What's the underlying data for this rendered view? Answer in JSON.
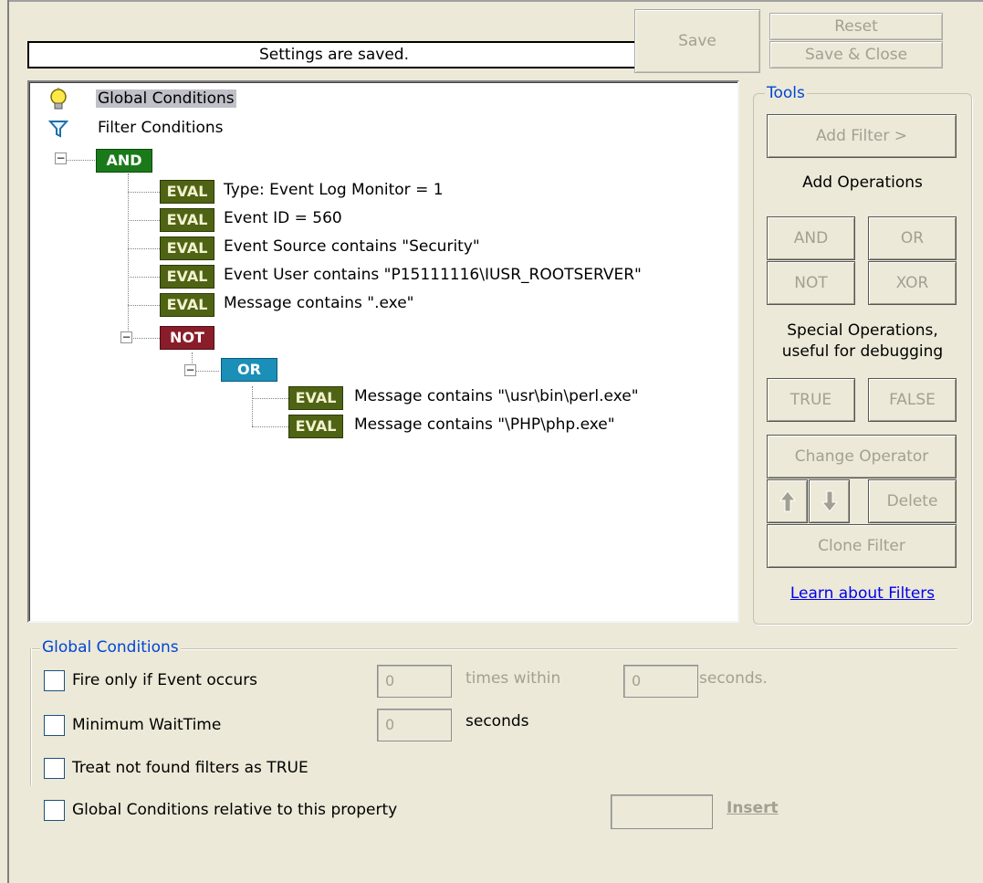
{
  "status": {
    "message": "Settings are saved."
  },
  "buttons": {
    "save": "Save",
    "reset": "Reset",
    "save_close": "Save & Close"
  },
  "tree": {
    "global": "Global Conditions",
    "filter": "Filter Conditions",
    "and": "AND",
    "not": "NOT",
    "or": "OR",
    "eval": "EVAL",
    "evals": [
      "Type: Event Log Monitor = 1",
      "Event ID = 560",
      "Event Source contains \"Security\"",
      "Event User contains \"P15111116\\IUSR_ROOTSERVER\"",
      "Message contains \".exe\""
    ],
    "or_evals": [
      "Message contains \"\\usr\\bin\\perl.exe\"",
      "Message contains \"\\PHP\\php.exe\""
    ]
  },
  "tools": {
    "title": "Tools",
    "add_filter": "Add Filter >",
    "add_operations": "Add Operations",
    "and": "AND",
    "or": "OR",
    "not": "NOT",
    "xor": "XOR",
    "special_1": "Special Operations,",
    "special_2": "useful for debugging",
    "true": "TRUE",
    "false": "FALSE",
    "change_operator": "Change Operator",
    "delete": "Delete",
    "clone_filter": "Clone Filter",
    "learn": "Learn about Filters"
  },
  "global_conditions": {
    "title": "Global Conditions",
    "fire_only": "Fire only if Event occurs",
    "fire_count": "0",
    "times_within": "times within",
    "fire_seconds": "0",
    "seconds_dot": "seconds.",
    "min_wait": "Minimum WaitTime",
    "min_wait_value": "0",
    "seconds": "seconds",
    "treat_true": "Treat not found filters as TRUE",
    "relative": "Global Conditions relative to this property",
    "relative_value": "",
    "insert": "Insert"
  }
}
